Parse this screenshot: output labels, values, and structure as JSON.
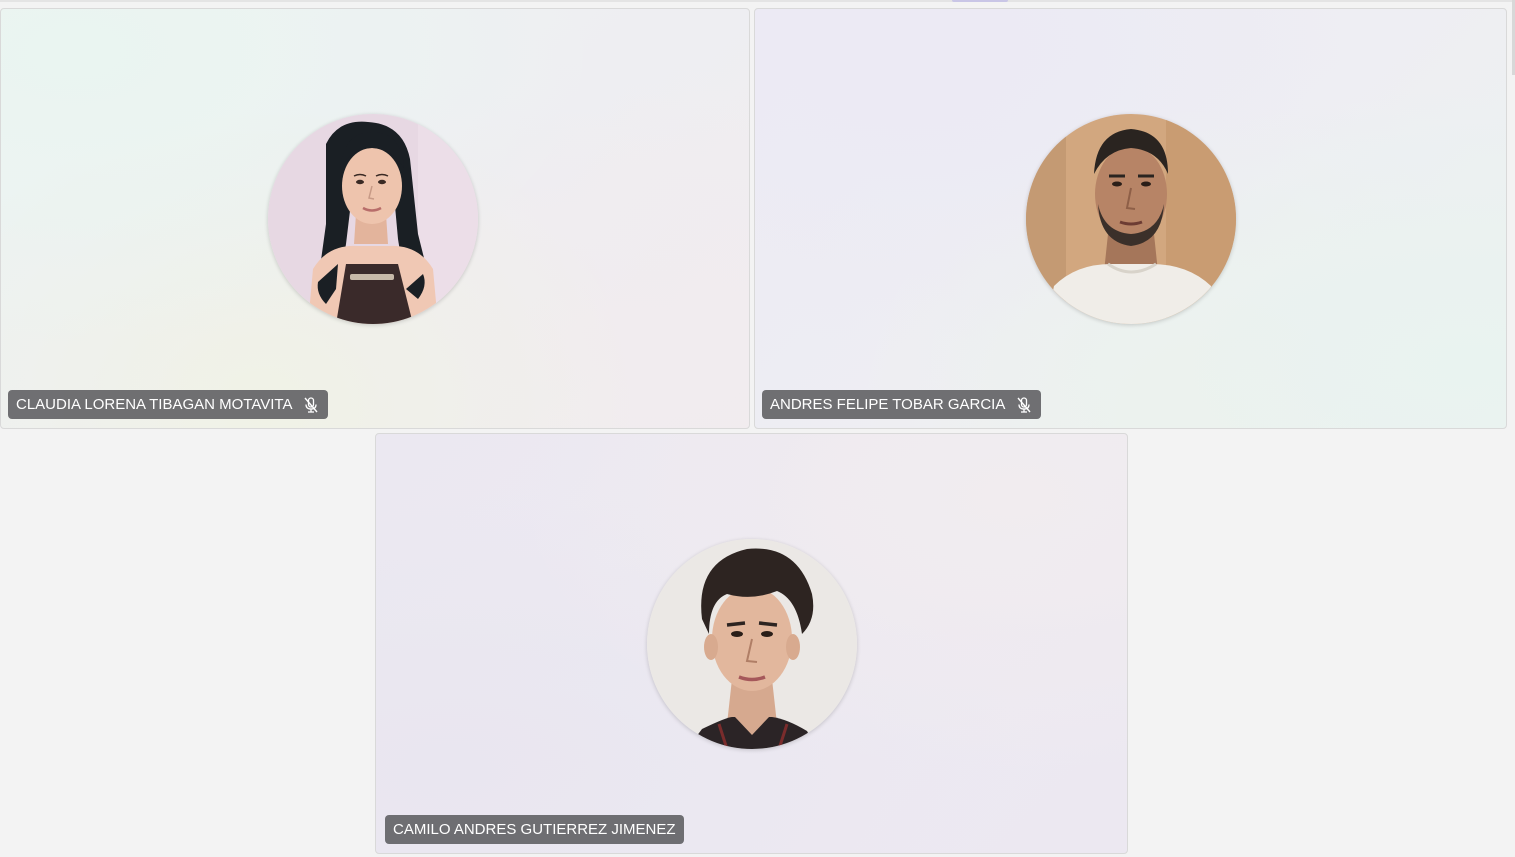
{
  "participants": [
    {
      "name": "CLAUDIA LORENA TIBAGAN MOTAVITA",
      "muted": true,
      "mic_icon": "mic-off-icon",
      "avatar_icon": "participant-photo"
    },
    {
      "name": "ANDRES FELIPE TOBAR GARCIA",
      "muted": true,
      "mic_icon": "mic-off-icon",
      "avatar_icon": "participant-photo"
    },
    {
      "name": "CAMILO ANDRES GUTIERREZ JIMENEZ",
      "muted": false,
      "avatar_icon": "participant-photo"
    }
  ],
  "colors": {
    "badge_background": "#606064",
    "badge_text": "#ffffff",
    "page_background": "#f3f3f3",
    "tile_border": "#d9d9d9",
    "active_indicator": "#c9c6e6"
  }
}
